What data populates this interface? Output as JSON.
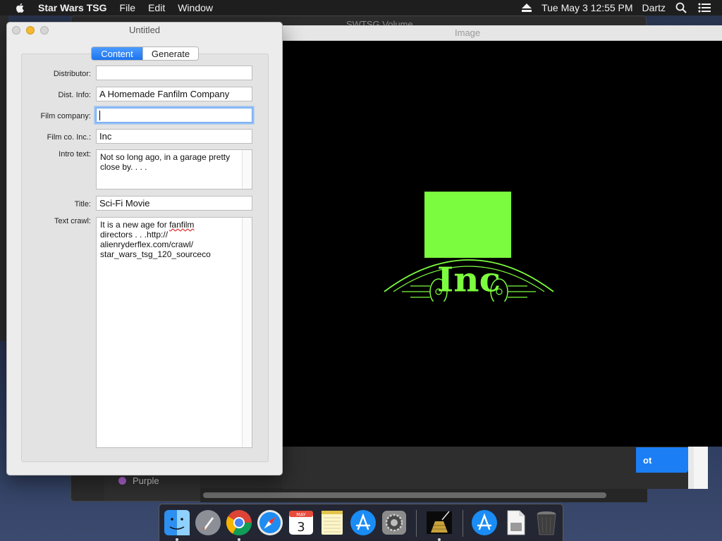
{
  "menubar": {
    "app_name": "Star Wars TSG",
    "menus": [
      "File",
      "Edit",
      "Window"
    ],
    "clock": "Tue May 3  12:55 PM",
    "user": "Dartz",
    "icons": [
      "apple-icon",
      "eject-icon",
      "search-icon",
      "list-icon"
    ]
  },
  "background_window": {
    "title": "SWTSG Volume",
    "sidebar_item": "Purple",
    "sidebar_item_color": "#b164d8",
    "button_partial_text": "ot",
    "button_color": "#1b7ef5"
  },
  "image_window": {
    "title": "Image",
    "logo_text": "Inc",
    "logo_color": "#7cfc3e"
  },
  "untitled_window": {
    "title": "Untitled",
    "tabs": [
      {
        "label": "Content",
        "active": true
      },
      {
        "label": "Generate",
        "active": false
      }
    ],
    "fields": {
      "distributor": {
        "label": "Distributor:",
        "value": ""
      },
      "dist_info": {
        "label": "Dist. Info:",
        "value": "A Homemade Fanfilm Company"
      },
      "film_company": {
        "label": "Film company:",
        "value": ""
      },
      "film_co_inc": {
        "label": "Film co. Inc.:",
        "value": "Inc"
      },
      "intro_text": {
        "label": "Intro text:",
        "value": "Not so long ago, in a garage pretty close by. . . ."
      },
      "title": {
        "label": "Title:",
        "value": "Sci-Fi Movie"
      },
      "text_crawl": {
        "label": "Text crawl:",
        "line1_prefix": "It is a new age for ",
        "line1_misspelled": "fanfilm",
        "rest": "directors . .  .http://\nalienryderflex.com/crawl/\nstar_wars_tsg_120_sourceco"
      }
    }
  },
  "dock": {
    "date_month": "MAY",
    "date_day": "3",
    "apps": [
      "finder-icon",
      "launchpad-icon",
      "chrome-icon",
      "safari-icon",
      "calendar-icon",
      "notes-icon",
      "app-store-icon",
      "system-preferences-icon",
      "star-wars-tsg-icon",
      "app-store-folder-icon",
      "document-icon",
      "trash-icon"
    ]
  }
}
